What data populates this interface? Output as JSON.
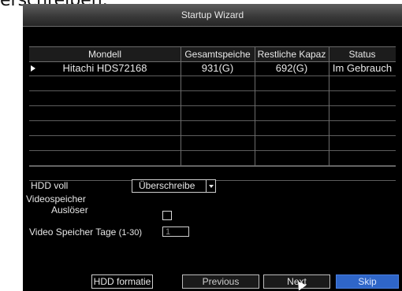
{
  "page": {
    "top_text": "erschreiben."
  },
  "window": {
    "title": "Startup Wizard"
  },
  "table": {
    "columns": [
      "Mondell",
      "Gesamtspeiche",
      "Restliche Kapaz",
      "Status"
    ],
    "rows": [
      {
        "model": "Hitachi HDS72168",
        "total": "931(G)",
        "remaining": "692(G)",
        "status": "Im Gebrauch"
      }
    ]
  },
  "settings": {
    "hdd_full_label": "HDD voll",
    "hdd_full_value": "Überschreibe",
    "video_storage_label": "Videospeicher",
    "trigger_label": "Auslöser",
    "trigger_checked": false,
    "video_days_label": "Video Speicher Tage",
    "video_days_range": "(1-30)",
    "video_days_value": "1"
  },
  "buttons": {
    "hdd_format": "HDD formatie",
    "previous": "Previous",
    "next": "Next",
    "skip": "Skip"
  },
  "colors": {
    "accent": "#2f66c8",
    "background": "#000000"
  }
}
